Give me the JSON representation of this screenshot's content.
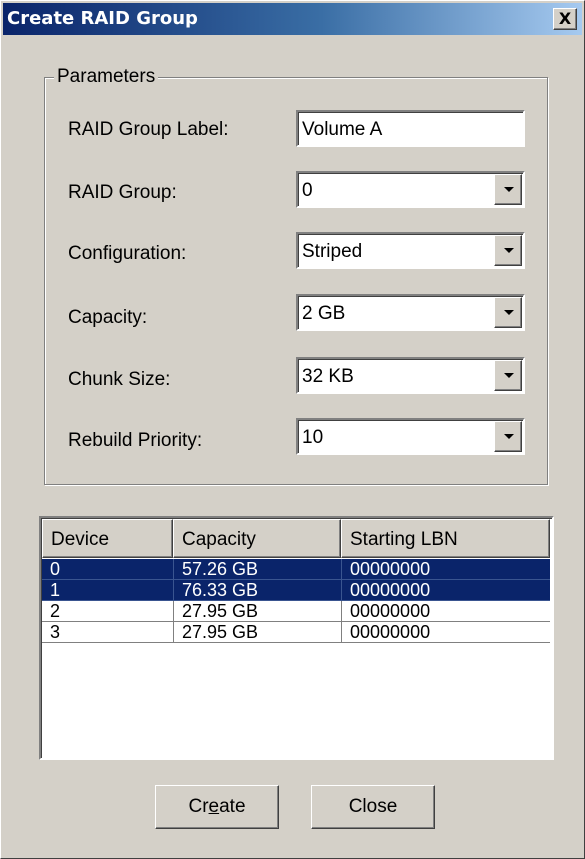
{
  "window": {
    "title": "Create RAID Group",
    "close_glyph": "X"
  },
  "parameters": {
    "legend": "Parameters",
    "fields": [
      {
        "label": "RAID Group Label:",
        "value": "Volume A",
        "type": "text"
      },
      {
        "label": "RAID Group:",
        "value": "0",
        "type": "dropdown"
      },
      {
        "label": "Configuration:",
        "value": "Striped",
        "type": "dropdown"
      },
      {
        "label": "Capacity:",
        "value": "2 GB",
        "type": "dropdown"
      },
      {
        "label": "Chunk Size:",
        "value": "32 KB",
        "type": "dropdown"
      },
      {
        "label": "Rebuild Priority:",
        "value": "10",
        "type": "dropdown"
      }
    ]
  },
  "device_table": {
    "columns": [
      "Device",
      "Capacity",
      "Starting LBN"
    ],
    "rows": [
      {
        "device": "0",
        "capacity": "57.26 GB",
        "lbn": "00000000",
        "selected": true
      },
      {
        "device": "1",
        "capacity": "76.33 GB",
        "lbn": "00000000",
        "selected": true
      },
      {
        "device": "2",
        "capacity": "27.95 GB",
        "lbn": "00000000",
        "selected": false
      },
      {
        "device": "3",
        "capacity": "27.95 GB",
        "lbn": "00000000",
        "selected": false
      }
    ]
  },
  "buttons": {
    "create": {
      "pre": "Cr",
      "mnemonic": "e",
      "post": "ate"
    },
    "close": "Close"
  },
  "colors": {
    "title_start": "#0a246a",
    "title_end": "#a6caf0",
    "selection": "#0a246a",
    "face": "#d4d0c8"
  }
}
